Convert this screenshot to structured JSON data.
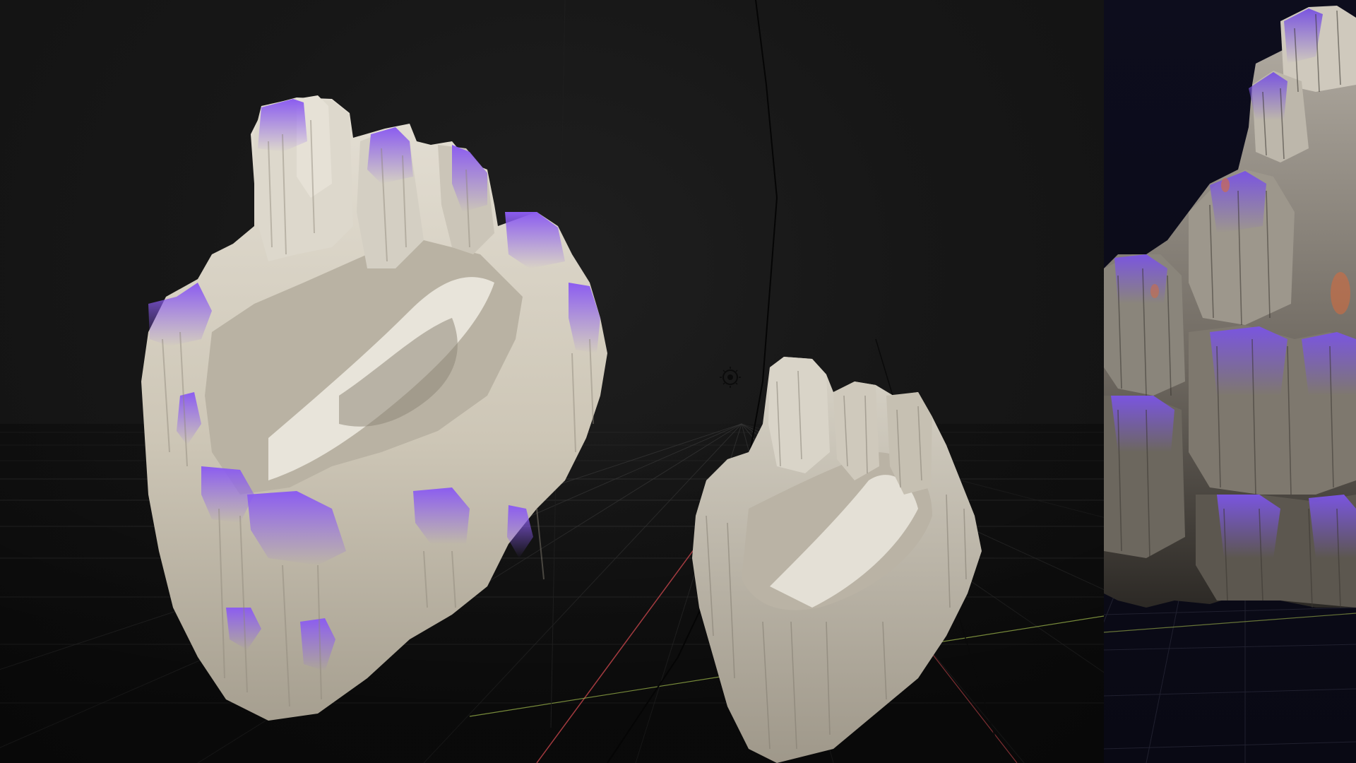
{
  "scene": {
    "background_color": "#121212",
    "grid_color": "#3f3f3f",
    "axis_x_color": "#c8464c",
    "axis_y_color": "#9bb44a",
    "crystal_primary": "#d9d4c8",
    "crystal_tip": "#8b5cf0",
    "side_panel_bg": "#0b0b18"
  },
  "objects": [
    {
      "name": "crystal-formation-large",
      "icon": "mesh-object"
    },
    {
      "name": "crystal-formation-small",
      "icon": "mesh-object"
    },
    {
      "name": "light-gizmo",
      "icon": "sun-light-icon"
    }
  ],
  "side_panel": {
    "name": "render-preview",
    "icon": "render-preview"
  }
}
